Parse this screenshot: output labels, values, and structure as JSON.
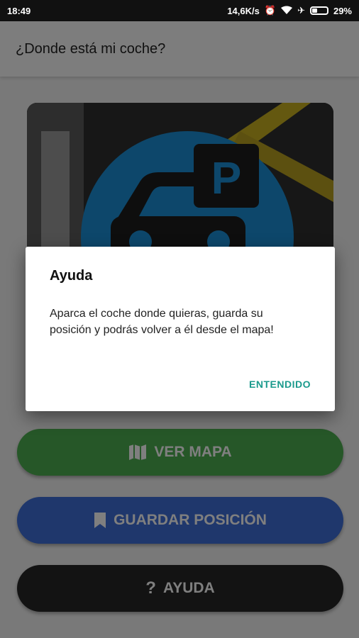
{
  "status_bar": {
    "time": "18:49",
    "speed": "14,6K/s",
    "battery": "29%",
    "icons": [
      "alarm-icon",
      "wifi-icon",
      "airplane-icon",
      "battery-icon"
    ]
  },
  "app_bar": {
    "title": "¿Donde está mi coche?"
  },
  "hero": {
    "image": "parking-sign-image",
    "colors": {
      "circle": "#1b8fd6",
      "sign": "#1c1c1c"
    }
  },
  "buttons": {
    "map": {
      "label": "VER MAPA",
      "icon": "map-icon",
      "color": "#4caf50"
    },
    "save": {
      "label": "GUARDAR POSICIÓN",
      "icon": "bookmark-icon",
      "color": "#3f6fd8"
    },
    "help": {
      "label": "AYUDA",
      "icon": "question-icon",
      "color": "#262626"
    }
  },
  "dialog": {
    "title": "Ayuda",
    "message": "Aparca el coche donde quieras, guarda su posición y podrás volver a él desde el mapa!",
    "action": "ENTENDIDO",
    "action_color": "#1a9a8c"
  }
}
